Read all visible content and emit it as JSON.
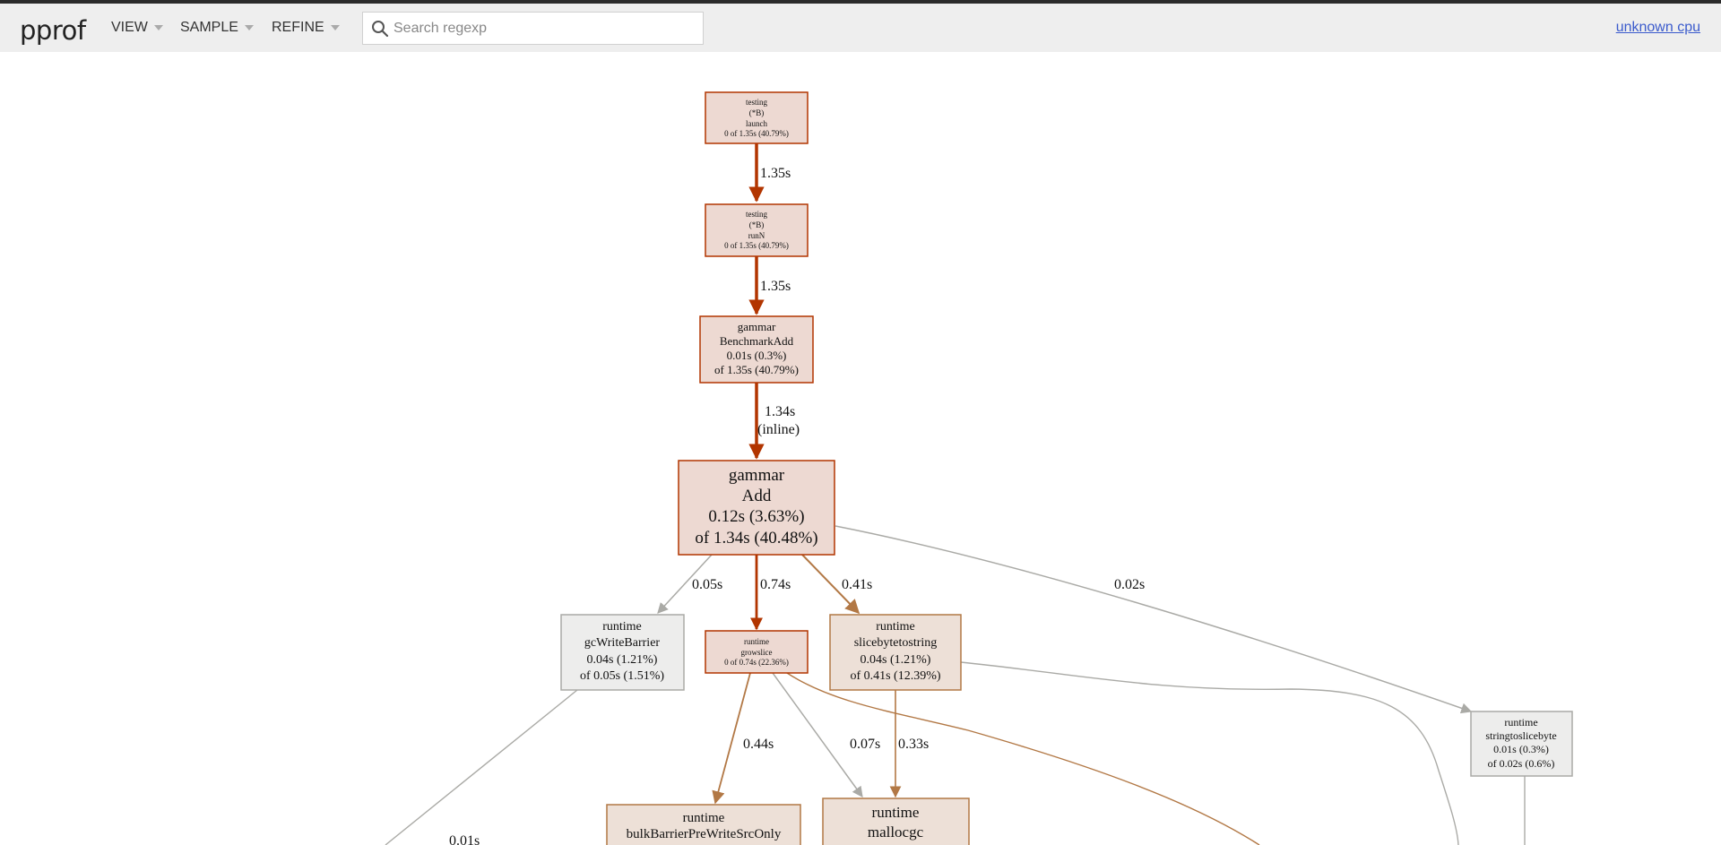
{
  "header": {
    "logo": "pprof",
    "menus": [
      {
        "label": "VIEW"
      },
      {
        "label": "SAMPLE"
      },
      {
        "label": "REFINE"
      }
    ],
    "search": {
      "placeholder": "Search regexp",
      "value": ""
    },
    "cpu_link": "unknown cpu"
  },
  "colors": {
    "hot_stroke": "#b23500",
    "hot_fill": "#edd9d2",
    "warm_stroke": "#b27845",
    "warm_fill": "#ede0d7",
    "cold_stroke": "#aaaaa6",
    "cold_fill": "#ededec"
  },
  "graph": {
    "nodes": {
      "launch": [
        "testing",
        "(*B)",
        "launch",
        "0 of 1.35s (40.79%)"
      ],
      "runN": [
        "testing",
        "(*B)",
        "runN",
        "0 of 1.35s (40.79%)"
      ],
      "benchmark": [
        "gammar",
        "BenchmarkAdd",
        "0.01s (0.3%)",
        "of 1.35s (40.79%)"
      ],
      "add": [
        "gammar",
        "Add",
        "0.12s (3.63%)",
        "of 1.34s (40.48%)"
      ],
      "gcwb": [
        "runtime",
        "gcWriteBarrier",
        "0.04s (1.21%)",
        "of 0.05s (1.51%)"
      ],
      "growslice": [
        "runtime",
        "growslice",
        "0 of 0.74s (22.36%)"
      ],
      "slicebyte": [
        "runtime",
        "slicebytetostring",
        "0.04s (1.21%)",
        "of 0.41s (12.39%)"
      ],
      "stringtoslice": [
        "runtime",
        "stringtoslicebyte",
        "0.01s (0.3%)",
        "of 0.02s (0.6%)"
      ],
      "bulkbarrier": [
        "runtime",
        "bulkBarrierPreWriteSrcOnly"
      ],
      "mallocgc": [
        "runtime",
        "mallocgc"
      ]
    },
    "edges": {
      "launch_runN": "1.35s",
      "runN_bench": "1.35s",
      "bench_add": [
        "1.34s",
        "(inline)"
      ],
      "add_gcwb": "0.05s",
      "add_growslice": "0.74s",
      "add_slicebyte": "0.41s",
      "add_stringtoslice": "0.02s",
      "growslice_bulk": "0.44s",
      "growslice_malloc": "0.07s",
      "slicebyte_malloc": "0.33s",
      "gcwb_off": "0.01s"
    }
  }
}
